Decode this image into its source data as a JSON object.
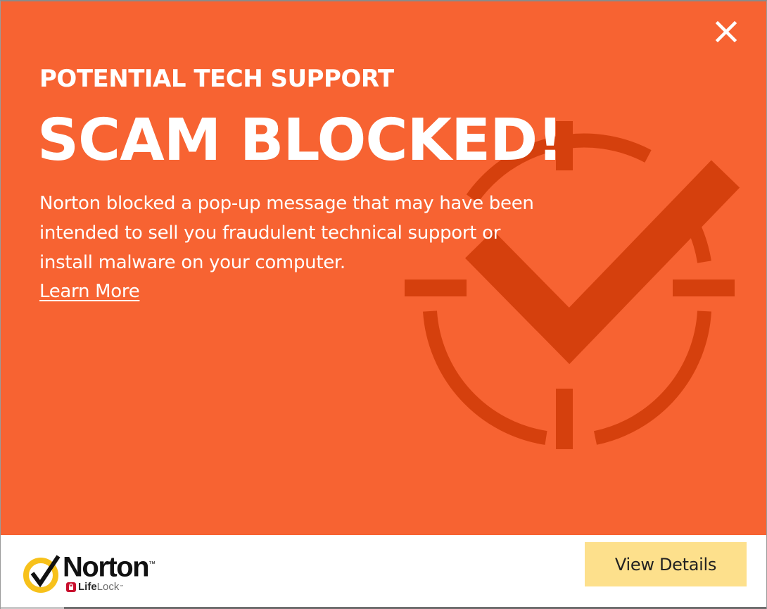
{
  "dialog": {
    "close_icon": "close-icon",
    "subtitle": "POTENTIAL TECH SUPPORT",
    "title": "SCAM BLOCKED!",
    "message": "Norton blocked a pop-up message that may have been intended to sell you fraudulent technical support or install malware on your computer.",
    "learn_more": "Learn More",
    "background_icon": "target-checkmark-icon"
  },
  "footer": {
    "logo": {
      "brand": "Norton",
      "trademark": "™",
      "sub_bold": "Life",
      "sub_light": "Lock",
      "trademark_sub": "™"
    },
    "view_details_label": "View Details"
  },
  "colors": {
    "panel_background": "#f76332",
    "emblem": "#d5400d",
    "text": "#ffffff",
    "button_background": "#fde08c",
    "logo_yellow": "#f7c11b",
    "logo_red": "#c8102e"
  }
}
